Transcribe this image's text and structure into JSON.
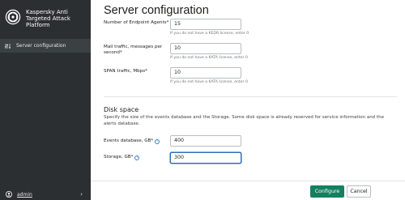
{
  "app": {
    "brand_name": "Kaspersky Anti Targeted Attack Platform"
  },
  "sidebar": {
    "items": [
      {
        "label": "Server configuration",
        "icon": "server-config-icon",
        "active": true
      }
    ],
    "user": {
      "name": "admin",
      "icon": "user-icon",
      "chevron": "›"
    }
  },
  "page": {
    "title": "Server configuration"
  },
  "fields": {
    "endpoint_agents": {
      "label": "Number of Endpoint Agents*",
      "value": "15",
      "hint": "If you do not have a KEDR license, enter 0"
    },
    "mail_traffic": {
      "label": "Mail traffic, messages per second*",
      "value": "10",
      "hint": "If you do not have a KATA license, enter 0"
    },
    "span_traffic": {
      "label": "SPAN traffic, Mbps*",
      "value": "10",
      "hint": "If you do not have a KATA license, enter 0"
    }
  },
  "disk_space": {
    "title": "Disk space",
    "description": "Specify the size of the events database and the Storage. Some disk space is already reserved for service information and the alerts database.",
    "events_db": {
      "label": "Events database, GB*",
      "value": "400"
    },
    "storage": {
      "label": "Storage, GB*",
      "value": "300"
    }
  },
  "buttons": {
    "configure": "Configure",
    "cancel": "Cancel"
  },
  "colors": {
    "sidebar_bg": "#2b2f31",
    "active_item_bg": "#3b4043",
    "primary_button": "#14805e",
    "info_icon": "#2e7fd0",
    "focus_border": "#2d6fb6"
  }
}
